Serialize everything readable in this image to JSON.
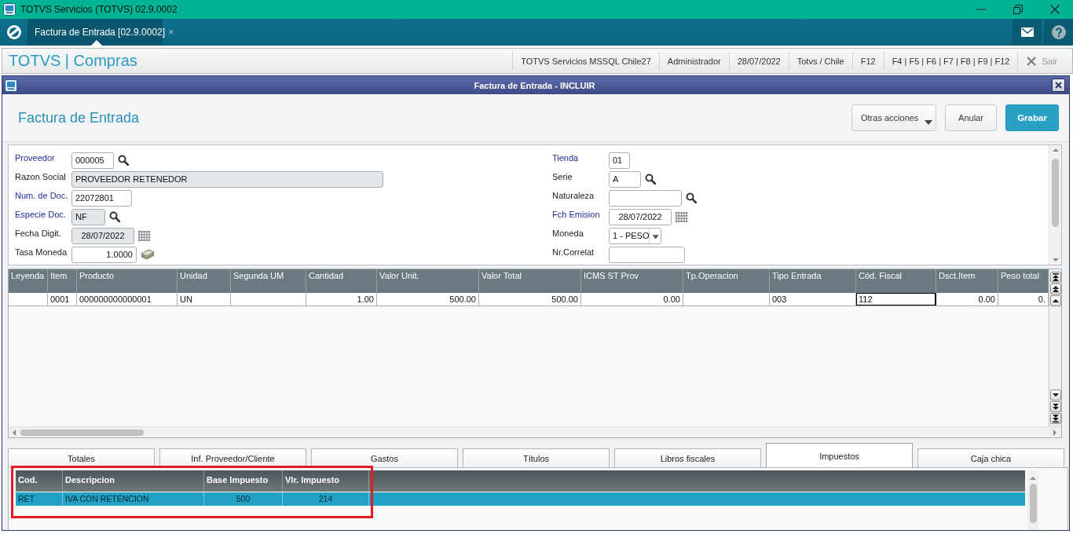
{
  "window": {
    "title": "TOTVS Servicios (TOTVS) 02.9.0002"
  },
  "app_tabs": [
    {
      "label": "Factura de Entrada [02.9.0002]",
      "close": "×",
      "selected": true
    }
  ],
  "header": {
    "title": "TOTVS | Compras",
    "items": [
      "TOTVS Servicios MSSQL Chile27",
      "Administrador",
      "28/07/2022",
      "Totvs / Chile",
      "F12",
      "F4 | F5 | F6 | F7 | F8 | F9 | F12"
    ],
    "exit_label": "Sair"
  },
  "dialog": {
    "title": "Factura de Entrada - INCLUIR",
    "heading": "Factura de Entrada",
    "buttons": [
      {
        "label": "Otras acciones",
        "kind": "menu"
      },
      {
        "label": "Anular",
        "kind": "secondary"
      },
      {
        "label": "Grabar",
        "kind": "primary"
      }
    ]
  },
  "form": {
    "left": [
      {
        "label": "Proveedor",
        "required": true,
        "readonly": false,
        "kind": "lookup",
        "value": "000005"
      },
      {
        "label": "Razon Social",
        "required": false,
        "readonly": true,
        "kind": "text",
        "value": "PROVEEDOR RETENEDOR"
      },
      {
        "label": "Num. de Doc.",
        "required": true,
        "readonly": false,
        "kind": "text",
        "value": "22072801"
      },
      {
        "label": "Especie Doc.",
        "required": true,
        "readonly": true,
        "kind": "lookup",
        "value": "NF"
      },
      {
        "label": "Fecha Digit.",
        "required": false,
        "readonly": true,
        "kind": "date",
        "value": "28/07/2022"
      },
      {
        "label": "Tasa Moneda",
        "required": false,
        "readonly": false,
        "kind": "amount",
        "value": "1.0000"
      }
    ],
    "right": [
      {
        "label": "Tienda",
        "required": true,
        "readonly": false,
        "kind": "text",
        "value": "01"
      },
      {
        "label": "Serie",
        "required": false,
        "readonly": false,
        "kind": "lookup",
        "value": "A"
      },
      {
        "label": "Naturaleza",
        "required": false,
        "readonly": false,
        "kind": "lookup"
      },
      {
        "label": "Fch Emision",
        "required": true,
        "readonly": false,
        "kind": "date",
        "value": "28/07/2022"
      },
      {
        "label": "Moneda",
        "required": false,
        "readonly": false,
        "kind": "select",
        "value": "1 - PESO"
      },
      {
        "label": "Nr.Correlat",
        "required": false,
        "readonly": false,
        "kind": "text"
      }
    ]
  },
  "items_grid": {
    "columns": [
      {
        "label": "Leyenda",
        "kind": "text"
      },
      {
        "label": "Item",
        "kind": "text"
      },
      {
        "label": "Producto",
        "kind": "text"
      },
      {
        "label": "Unidad",
        "kind": "text"
      },
      {
        "label": "Segunda UM",
        "kind": "text"
      },
      {
        "label": "Cantidad",
        "kind": "number"
      },
      {
        "label": "Valor Unit.",
        "kind": "number"
      },
      {
        "label": "Valor Total",
        "kind": "number"
      },
      {
        "label": "ICMS ST Prov",
        "kind": "number"
      },
      {
        "label": "Tp.Operacion",
        "kind": "text"
      },
      {
        "label": "Tipo Entrada",
        "kind": "text"
      },
      {
        "label": "Cód. Fiscal",
        "kind": "text"
      },
      {
        "label": "Dsct.Item",
        "kind": "number"
      },
      {
        "label": "Peso total",
        "kind": "number"
      }
    ],
    "rows": [
      {
        "cells": [
          {
            "focused": false
          },
          {
            "text": "0001",
            "focused": false
          },
          {
            "text": "000000000000001",
            "focused": false
          },
          {
            "text": "UN",
            "focused": false
          },
          {
            "focused": false
          },
          {
            "text": "1.00",
            "focused": false
          },
          {
            "text": "500.00",
            "focused": false
          },
          {
            "text": "500.00",
            "focused": false
          },
          {
            "text": "0.00",
            "focused": false
          },
          {
            "focused": false
          },
          {
            "text": "003",
            "focused": false
          },
          {
            "text": "112",
            "focused": true
          },
          {
            "text": "0.00",
            "focused": false
          },
          {
            "text": "0.",
            "focused": false
          }
        ]
      }
    ]
  },
  "tabs": [
    {
      "label": "Totales",
      "selected": false
    },
    {
      "label": "Inf. Proveedor/Cliente",
      "selected": false
    },
    {
      "label": "Gastos",
      "selected": false
    },
    {
      "label": "Títulos",
      "selected": false
    },
    {
      "label": "Libros fiscales",
      "selected": false
    },
    {
      "label": "Impuestos",
      "selected": true
    },
    {
      "label": "Caja chica",
      "selected": false
    }
  ],
  "taxes_grid": {
    "highlighted": true,
    "columns": [
      {
        "label": "Cod.",
        "kind": "text"
      },
      {
        "label": "Descripcion",
        "kind": "text"
      },
      {
        "label": "Base Impuesto",
        "kind": "number"
      },
      {
        "label": "Vlr. Impuesto",
        "kind": "number"
      }
    ],
    "rows": [
      {
        "cells": [
          "RET",
          "IVA CON RETENCION",
          "500",
          "214"
        ],
        "selected": true
      }
    ]
  }
}
